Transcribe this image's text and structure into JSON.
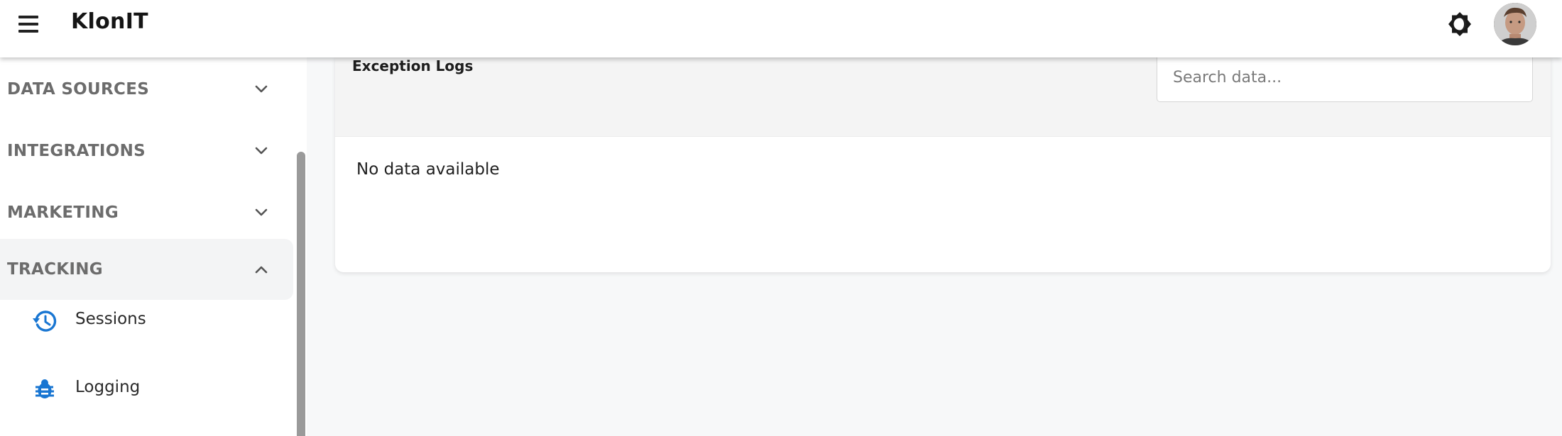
{
  "header": {
    "brand": "KlonIT",
    "menu_icon": "hamburger-menu-icon",
    "theme_icon": "brightness-icon",
    "avatar_icon": "user-avatar"
  },
  "sidebar": {
    "groups": [
      {
        "label": "DATA SOURCES",
        "icon": "chevron-down-icon",
        "expanded": false
      },
      {
        "label": "INTEGRATIONS",
        "icon": "chevron-down-icon",
        "expanded": false
      },
      {
        "label": "MARKETING",
        "icon": "chevron-down-icon",
        "expanded": false
      },
      {
        "label": "TRACKING",
        "icon": "chevron-up-icon",
        "expanded": true
      }
    ],
    "tracking_items": [
      {
        "label": "Sessions",
        "icon": "history-icon"
      },
      {
        "label": "Logging",
        "icon": "bug-icon"
      }
    ]
  },
  "main": {
    "title": "Exception Logs",
    "search_placeholder": "Search data...",
    "search_value": "",
    "empty_text": "No data available"
  },
  "colors": {
    "accent": "#1976d2",
    "active_bg": "#f3f4f5",
    "page_bg": "#f7f8f9"
  }
}
